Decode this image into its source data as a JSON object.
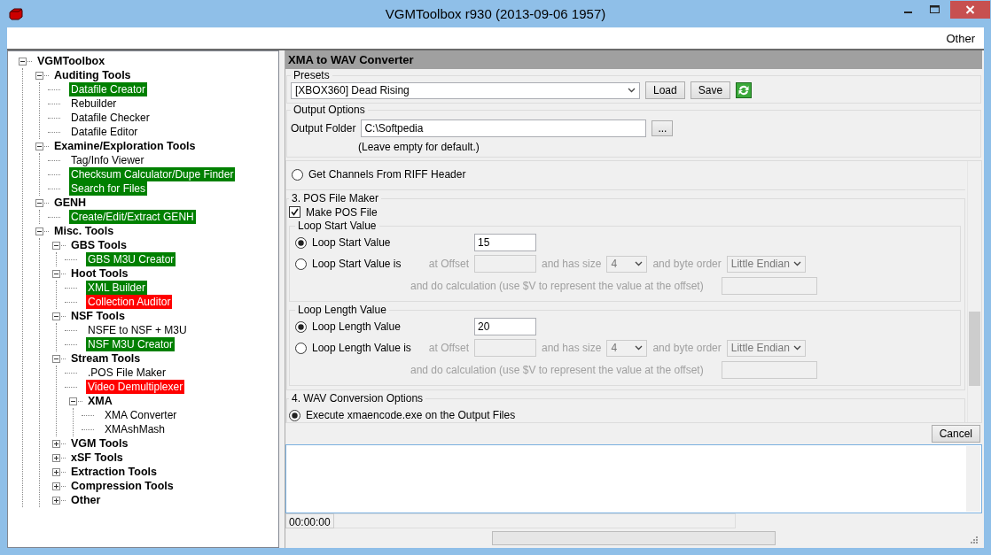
{
  "window": {
    "title": "VGMToolbox r930 (2013-09-06 1957)"
  },
  "menu": [
    {
      "label": "Other"
    }
  ],
  "tree": {
    "label": "VGMToolbox",
    "kind": "group",
    "expanded": true,
    "children": [
      {
        "label": "Auditing Tools",
        "kind": "group",
        "expanded": true,
        "children": [
          {
            "label": "Datafile Creator",
            "kind": "leaf",
            "color": "#008000"
          },
          {
            "label": "Rebuilder",
            "kind": "leaf"
          },
          {
            "label": "Datafile Checker",
            "kind": "leaf"
          },
          {
            "label": "Datafile Editor",
            "kind": "leaf"
          }
        ]
      },
      {
        "label": "Examine/Exploration Tools",
        "kind": "group",
        "expanded": true,
        "children": [
          {
            "label": "Tag/Info Viewer",
            "kind": "leaf"
          },
          {
            "label": "Checksum Calculator/Dupe Finder",
            "kind": "leaf",
            "color": "#008000"
          },
          {
            "label": "Search for Files",
            "kind": "leaf",
            "color": "#008000"
          }
        ]
      },
      {
        "label": "GENH",
        "kind": "group",
        "expanded": true,
        "children": [
          {
            "label": "Create/Edit/Extract GENH",
            "kind": "leaf",
            "color": "#008000"
          }
        ]
      },
      {
        "label": "Misc. Tools",
        "kind": "group",
        "expanded": true,
        "children": [
          {
            "label": "GBS Tools",
            "kind": "group",
            "expanded": true,
            "children": [
              {
                "label": "GBS M3U Creator",
                "kind": "leaf",
                "color": "#008000"
              }
            ]
          },
          {
            "label": "Hoot Tools",
            "kind": "group",
            "expanded": true,
            "children": [
              {
                "label": "XML Builder",
                "kind": "leaf",
                "color": "#008000"
              },
              {
                "label": "Collection Auditor",
                "kind": "leaf",
                "color": "#ff0000"
              }
            ]
          },
          {
            "label": "NSF Tools",
            "kind": "group",
            "expanded": true,
            "children": [
              {
                "label": "NSFE to NSF + M3U",
                "kind": "leaf"
              },
              {
                "label": "NSF M3U Creator",
                "kind": "leaf",
                "color": "#008000"
              }
            ]
          },
          {
            "label": "Stream Tools",
            "kind": "group",
            "expanded": true,
            "children": [
              {
                "label": ".POS File Maker",
                "kind": "leaf"
              },
              {
                "label": "Video Demultiplexer",
                "kind": "leaf",
                "color": "#ff0000"
              },
              {
                "label": "XMA",
                "kind": "group",
                "expanded": true,
                "children": [
                  {
                    "label": "XMA Converter",
                    "kind": "leaf"
                  },
                  {
                    "label": "XMAshMash",
                    "kind": "leaf"
                  }
                ]
              }
            ]
          },
          {
            "label": "VGM Tools",
            "kind": "group",
            "expanded": false
          },
          {
            "label": "xSF Tools",
            "kind": "group",
            "expanded": false
          },
          {
            "label": "Extraction Tools",
            "kind": "group",
            "expanded": false
          },
          {
            "label": "Compression Tools",
            "kind": "group",
            "expanded": false
          },
          {
            "label": "Other",
            "kind": "group",
            "expanded": false
          }
        ]
      }
    ]
  },
  "panel": {
    "title": "XMA to WAV Converter",
    "presets": {
      "label": "Presets",
      "value": "[XBOX360] Dead Rising",
      "buttons": [
        "Load",
        "Save"
      ]
    },
    "output_options": {
      "label": "Output Options",
      "folder_label": "Output Folder",
      "folder_value": "C:\\Softpedia",
      "browse_button": "...",
      "hint": "(Leave empty for default.)"
    },
    "riff_option": {
      "label": "Get Channels From RIFF Header",
      "selected": false
    },
    "pos_section": {
      "title": "3. POS File Maker",
      "make_pos": {
        "label": "Make POS File",
        "checked": true
      },
      "groups": [
        {
          "title": "Loop Start Value",
          "options": [
            {
              "kind": "value",
              "label": "Loop Start Value",
              "selected": true,
              "value": "15"
            },
            {
              "kind": "offset",
              "label": "Loop Start Value is",
              "selected": false,
              "disabled": true,
              "offset_label": "at Offset",
              "size_label": "and has size",
              "size": "4",
              "order_label": "and byte order",
              "order": "Little Endian",
              "calc_label": "and do calculation (use $V to represent the value at the offset)"
            }
          ]
        },
        {
          "title": "Loop Length Value",
          "options": [
            {
              "kind": "value",
              "label": "Loop Length Value",
              "selected": true,
              "value": "20"
            },
            {
              "kind": "offset",
              "label": "Loop Length Value is",
              "selected": false,
              "disabled": true,
              "offset_label": "at Offset",
              "size_label": "and has size",
              "size": "4",
              "order_label": "and byte order",
              "order": "Little Endian",
              "calc_label": "and do calculation (use $V to represent the value at the offset)"
            }
          ]
        }
      ]
    },
    "wav_section": {
      "title": "4. WAV Conversion Options",
      "options": [
        {
          "label": "Execute xmaencode.exe on the Output Files",
          "selected": true
        }
      ]
    },
    "cancel_button": "Cancel",
    "status": {
      "time": "00:00:00"
    },
    "progress": {
      "level": 0
    }
  }
}
